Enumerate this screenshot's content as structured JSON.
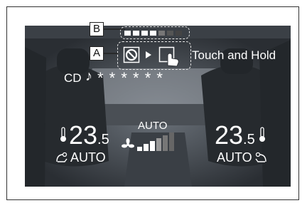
{
  "labels": {
    "a": "A",
    "b": "B"
  },
  "gesture": {
    "touch_and_hold": "Touch and Hold"
  },
  "audio": {
    "source": "CD",
    "track": "* * * * * *"
  },
  "climate": {
    "left": {
      "temp_int": "23",
      "temp_dec": ".5",
      "mode": "AUTO"
    },
    "right": {
      "temp_int": "23",
      "temp_dec": ".5",
      "mode": "AUTO"
    },
    "fan_mode": "AUTO"
  },
  "icons": {
    "prohibited": "prohibited-icon",
    "arrow": "triangle-right-icon",
    "touch": "hand-touch-icon",
    "music": "music-note-icon",
    "thermometer": "thermometer-icon",
    "airflow": "airflow-icon",
    "fan": "fan-icon"
  },
  "colors": {
    "screen_bg": "#2f3338",
    "text": "#ffffff",
    "dashed": "#e6e6e6"
  }
}
